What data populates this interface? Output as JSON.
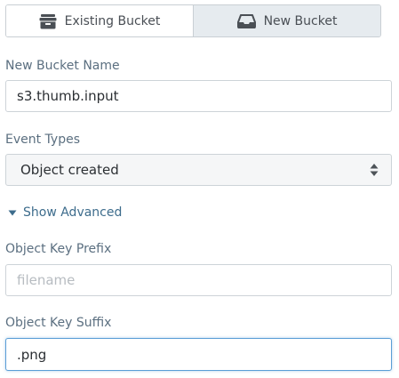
{
  "bucket_toggle": {
    "existing_label": "Existing Bucket",
    "new_label": "New Bucket",
    "selected": "New Bucket"
  },
  "new_bucket_name": {
    "label": "New Bucket Name",
    "value": "s3.thumb.input"
  },
  "event_types": {
    "label": "Event Types",
    "selected": "Object created"
  },
  "advanced": {
    "label": "Show Advanced"
  },
  "object_key_prefix": {
    "label": "Object Key Prefix",
    "value": "",
    "placeholder": "filename"
  },
  "object_key_suffix": {
    "label": "Object Key Suffix",
    "value": ".png"
  },
  "icons": {
    "existing": "archive-box-icon",
    "new": "inbox-tray-icon",
    "select": "sort-arrows-icon",
    "advanced": "caret-down-icon"
  },
  "colors": {
    "active_toggle_bg": "#e6ebef",
    "label_text": "#5b6f80",
    "link_text": "#3d6c8c",
    "focus_border": "#5b9ed6"
  }
}
